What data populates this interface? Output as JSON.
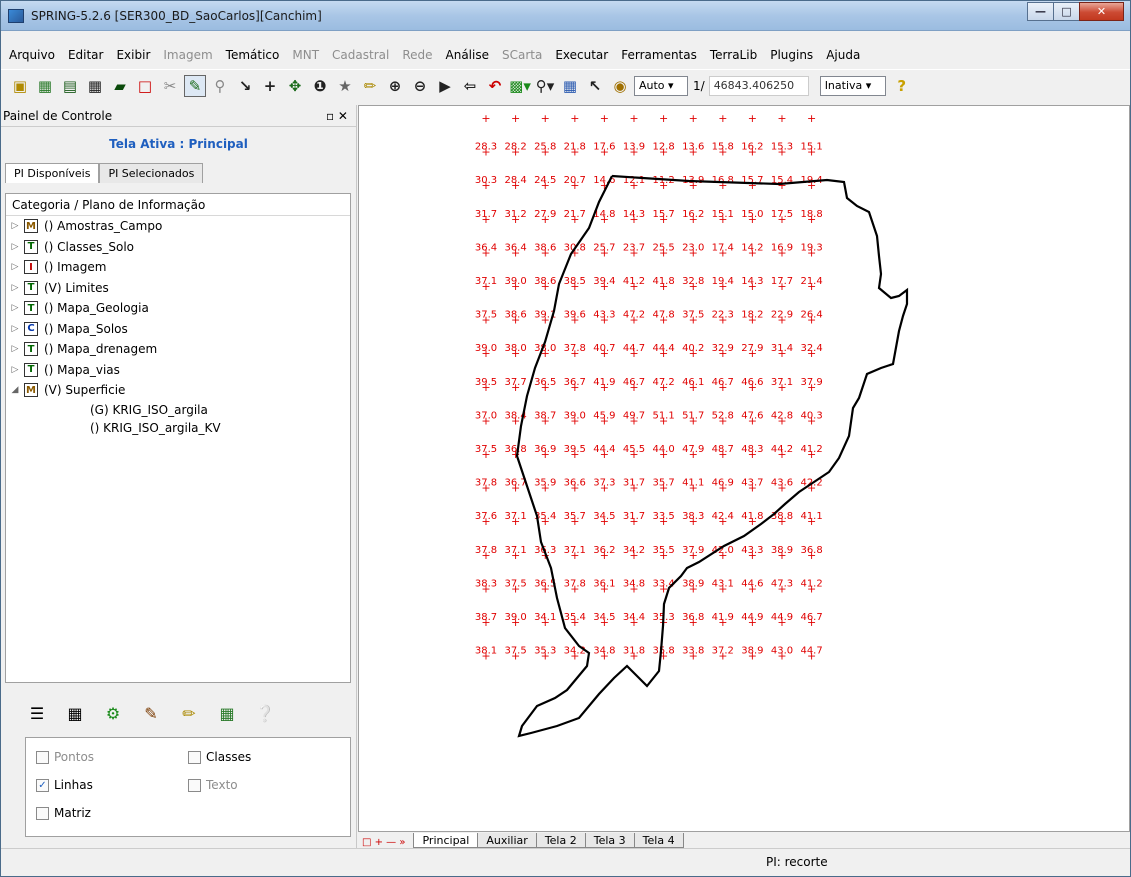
{
  "window": {
    "title": "SPRING-5.2.6 [SER300_BD_SaoCarlos][Canchim]"
  },
  "menu": [
    {
      "label": "Arquivo",
      "enabled": true
    },
    {
      "label": "Editar",
      "enabled": true
    },
    {
      "label": "Exibir",
      "enabled": true
    },
    {
      "label": "Imagem",
      "enabled": false
    },
    {
      "label": "Temático",
      "enabled": true
    },
    {
      "label": "MNT",
      "enabled": false
    },
    {
      "label": "Cadastral",
      "enabled": false
    },
    {
      "label": "Rede",
      "enabled": false
    },
    {
      "label": "Análise",
      "enabled": true
    },
    {
      "label": "SCarta",
      "enabled": false
    },
    {
      "label": "Executar",
      "enabled": true
    },
    {
      "label": "Ferramentas",
      "enabled": true
    },
    {
      "label": "TerraLib",
      "enabled": true
    },
    {
      "label": "Plugins",
      "enabled": true
    },
    {
      "label": "Ajuda",
      "enabled": true
    }
  ],
  "toolbar": {
    "scale_mode": "Auto",
    "scale_prefix": "1/",
    "scale_value": "46843.406250",
    "state": "Inativa",
    "help_icon": "?"
  },
  "panel": {
    "title": "Painel de Controle",
    "active_screen": "Tela Ativa : Principal",
    "tabs": [
      "PI Disponíveis",
      "PI Selecionados"
    ],
    "tree_header": "Categoria / Plano de Informação",
    "categories": [
      {
        "badge": "M",
        "label": "() Amostras_Campo",
        "expanded": false
      },
      {
        "badge": "T",
        "label": "() Classes_Solo",
        "expanded": false
      },
      {
        "badge": "I",
        "label": "() Imagem",
        "expanded": false
      },
      {
        "badge": "T",
        "label": "(V) Limites",
        "expanded": false
      },
      {
        "badge": "T",
        "label": "() Mapa_Geologia",
        "expanded": false
      },
      {
        "badge": "C",
        "label": "() Mapa_Solos",
        "expanded": false
      },
      {
        "badge": "T",
        "label": "() Mapa_drenagem",
        "expanded": false
      },
      {
        "badge": "T",
        "label": "() Mapa_vias",
        "expanded": false
      },
      {
        "badge": "M",
        "label": "(V) Superficie",
        "expanded": true
      }
    ],
    "planes": [
      "(G) KRIG_ISO_argila",
      "() KRIG_ISO_argila_KV"
    ],
    "options": {
      "pontos": {
        "label": "Pontos",
        "checked": false,
        "enabled": false
      },
      "classes": {
        "label": "Classes",
        "checked": false,
        "enabled": true
      },
      "linhas": {
        "label": "Linhas",
        "checked": true,
        "enabled": true
      },
      "texto": {
        "label": "Texto",
        "checked": false,
        "enabled": false
      },
      "matriz": {
        "label": "Matriz",
        "checked": false,
        "enabled": true
      }
    }
  },
  "map_tabs": [
    "Principal",
    "Auxiliar",
    "Tela 2",
    "Tela 3",
    "Tela 4"
  ],
  "status": {
    "pi": "PI: recorte"
  },
  "grid": {
    "label_color": "#e00000",
    "rows": [
      [
        "",
        "",
        "",
        "",
        "",
        "",
        "",
        "",
        "",
        "",
        "",
        ""
      ],
      [
        "28.3",
        "28.2",
        "25.8",
        "21.8",
        "17.6",
        "13.9",
        "12.8",
        "13.6",
        "15.8",
        "16.2",
        "15.3",
        "15.1"
      ],
      [
        "30.3",
        "28.4",
        "24.5",
        "20.7",
        "14.6",
        "12.1",
        "11.2",
        "13.9",
        "16.8",
        "15.7",
        "15.4",
        "19.4"
      ],
      [
        "31.7",
        "31.2",
        "27.9",
        "21.7",
        "14.8",
        "14.3",
        "15.7",
        "16.2",
        "15.1",
        "15.0",
        "17.5",
        "18.8"
      ],
      [
        "36.4",
        "36.4",
        "38.6",
        "30.8",
        "25.7",
        "23.7",
        "25.5",
        "23.0",
        "17.4",
        "14.2",
        "16.9",
        "19.3"
      ],
      [
        "37.1",
        "39.0",
        "38.6",
        "38.5",
        "39.4",
        "41.2",
        "41.8",
        "32.8",
        "19.4",
        "14.3",
        "17.7",
        "21.4"
      ],
      [
        "37.5",
        "38.6",
        "39.1",
        "39.6",
        "43.3",
        "47.2",
        "47.8",
        "37.5",
        "22.3",
        "18.2",
        "22.9",
        "26.4"
      ],
      [
        "39.0",
        "38.0",
        "38.0",
        "37.8",
        "40.7",
        "44.7",
        "44.4",
        "40.2",
        "32.9",
        "27.9",
        "31.4",
        "32.4"
      ],
      [
        "39.5",
        "37.7",
        "36.5",
        "36.7",
        "41.9",
        "46.7",
        "47.2",
        "46.1",
        "46.7",
        "46.6",
        "37.1",
        "37.9"
      ],
      [
        "37.0",
        "38.4",
        "38.7",
        "39.0",
        "45.9",
        "49.7",
        "51.1",
        "51.7",
        "52.8",
        "47.6",
        "42.8",
        "40.3"
      ],
      [
        "37.5",
        "36.8",
        "36.9",
        "39.5",
        "44.4",
        "45.5",
        "44.0",
        "47.9",
        "48.7",
        "48.3",
        "44.2",
        "41.2"
      ],
      [
        "37.8",
        "36.7",
        "35.9",
        "36.6",
        "37.3",
        "31.7",
        "35.7",
        "41.1",
        "46.9",
        "43.7",
        "43.6",
        "42.2"
      ],
      [
        "37.6",
        "37.1",
        "35.4",
        "35.7",
        "34.5",
        "31.7",
        "33.5",
        "38.3",
        "42.4",
        "41.8",
        "38.8",
        "41.1"
      ],
      [
        "37.8",
        "37.1",
        "36.3",
        "37.1",
        "36.2",
        "34.2",
        "35.5",
        "37.9",
        "42.0",
        "43.3",
        "38.9",
        "36.8"
      ],
      [
        "38.3",
        "37.5",
        "36.5",
        "37.8",
        "36.1",
        "34.8",
        "33.4",
        "38.9",
        "43.1",
        "44.6",
        "47.3",
        "41.2"
      ],
      [
        "38.7",
        "39.0",
        "34.1",
        "35.4",
        "34.5",
        "34.4",
        "35.3",
        "36.8",
        "41.9",
        "44.9",
        "44.9",
        "46.7"
      ],
      [
        "38.1",
        "37.5",
        "35.3",
        "34.2",
        "34.8",
        "31.8",
        "35.8",
        "33.8",
        "37.2",
        "38.9",
        "43.0",
        "44.7"
      ]
    ]
  }
}
